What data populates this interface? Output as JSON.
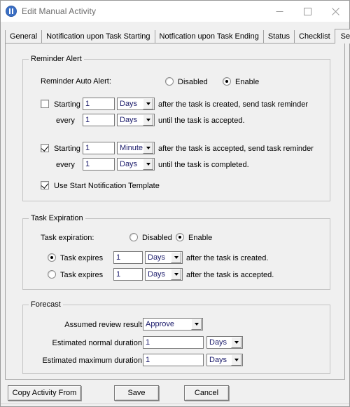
{
  "window": {
    "title": "Edit Manual Activity",
    "icon": "app-info-icon",
    "controls": {
      "minimize": "minimize-icon",
      "maximize": "maximize-icon",
      "close": "close-icon"
    }
  },
  "tabs": [
    {
      "label": "General",
      "active": false
    },
    {
      "label": "Notification upon Task Starting",
      "active": false
    },
    {
      "label": "Notfication upon Task Ending",
      "active": false
    },
    {
      "label": "Status",
      "active": false
    },
    {
      "label": "Checklist",
      "active": false
    },
    {
      "label": "Settings",
      "active": true
    }
  ],
  "reminder_alert": {
    "legend": "Reminder Alert",
    "auto_alert_label": "Reminder Auto Alert:",
    "auto_alert_options": [
      {
        "label": "Disabled",
        "selected": false
      },
      {
        "label": "Enable",
        "selected": true
      }
    ],
    "rule1": {
      "checkbox_label": "Starting",
      "checked": false,
      "start_value": "1",
      "start_unit": "Days",
      "start_text": "after the task is created, send task reminder",
      "every_label": "every",
      "every_value": "1",
      "every_unit": "Days",
      "every_text": "until the task is accepted."
    },
    "rule2": {
      "checkbox_label": "Starting",
      "checked": true,
      "start_value": "1",
      "start_unit": "Minutes",
      "start_text": "after the task is accepted, send task reminder",
      "every_label": "every",
      "every_value": "1",
      "every_unit": "Days",
      "every_text": "until the task is completed."
    },
    "use_template": {
      "label": "Use Start Notification Template",
      "checked": true
    }
  },
  "task_expiration": {
    "legend": "Task Expiration",
    "expiration_label": "Task expiration:",
    "expiration_options": [
      {
        "label": "Disabled",
        "selected": false
      },
      {
        "label": "Enable",
        "selected": true
      }
    ],
    "row1": {
      "radio_label": "Task expires",
      "selected": true,
      "value": "1",
      "unit": "Days",
      "text": "after the task is created."
    },
    "row2": {
      "radio_label": "Task expires",
      "selected": false,
      "value": "1",
      "unit": "Days",
      "text": "after the task is accepted."
    }
  },
  "forecast": {
    "legend": "Forecast",
    "review_result_label": "Assumed review result:",
    "review_result_value": "Approve",
    "normal_duration_label": "Estimated normal duration:",
    "normal_duration_value": "1",
    "normal_duration_unit": "Days",
    "max_duration_label": "Estimated maximum duration:",
    "max_duration_value": "1",
    "max_duration_unit": "Days"
  },
  "footer": {
    "copy_activity": "Copy Activity From",
    "save": "Save",
    "cancel": "Cancel"
  }
}
